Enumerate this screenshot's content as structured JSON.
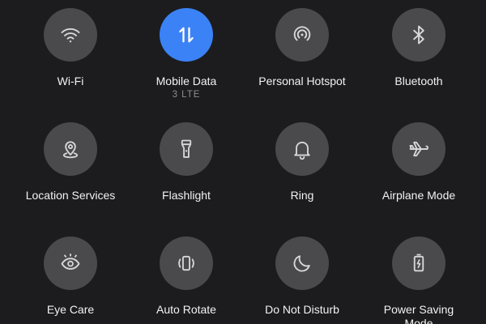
{
  "colors": {
    "background": "#1c1c1e",
    "tile_inactive": "#4a4a4c",
    "tile_active": "#3b82f6",
    "icon": "#d7d7d9",
    "label": "#f2f2f2",
    "sublabel": "#8d8d8f"
  },
  "tiles": [
    {
      "label": "Wi-Fi",
      "icon": "wifi-icon",
      "active": false
    },
    {
      "label": "Mobile Data",
      "sublabel": "3  LTE",
      "icon": "mobile-data-arrows-icon",
      "active": true
    },
    {
      "label": "Personal Hotspot",
      "icon": "hotspot-icon",
      "active": false
    },
    {
      "label": "Bluetooth",
      "icon": "bluetooth-icon",
      "active": false
    },
    {
      "label": "Location Services",
      "icon": "location-pin-icon",
      "active": false
    },
    {
      "label": "Flashlight",
      "icon": "flashlight-icon",
      "active": false
    },
    {
      "label": "Ring",
      "icon": "bell-icon",
      "active": false
    },
    {
      "label": "Airplane Mode",
      "icon": "airplane-icon",
      "active": false
    },
    {
      "label": "Eye Care",
      "icon": "eye-icon",
      "active": false
    },
    {
      "label": "Auto Rotate",
      "icon": "auto-rotate-icon",
      "active": false
    },
    {
      "label": "Do Not Disturb",
      "icon": "moon-icon",
      "active": false
    },
    {
      "label": "Power Saving Mode",
      "icon": "battery-saver-icon",
      "active": false
    }
  ]
}
